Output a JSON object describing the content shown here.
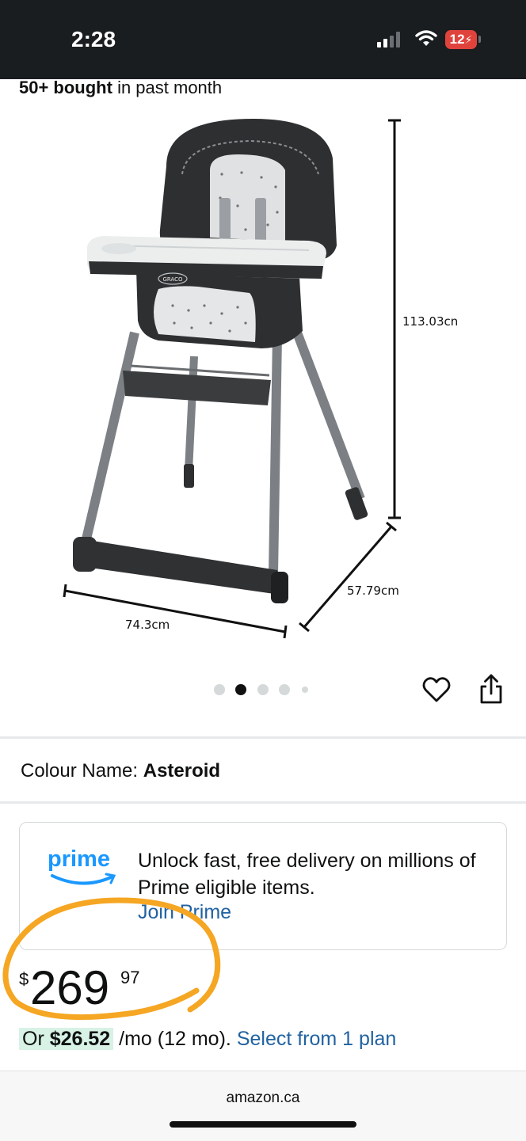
{
  "status_bar": {
    "time": "2:28",
    "battery": "12"
  },
  "product": {
    "bought": {
      "bold": "50+ bought",
      "rest": " in past month"
    },
    "dimensions": {
      "height": "113.03cn",
      "depth": "57.79cm",
      "width": "74.3cm"
    },
    "brand_badge": "GRACO",
    "image_count": 5,
    "active_image": 2
  },
  "variant": {
    "label": "Colour Name:",
    "value": "Asteroid"
  },
  "prime": {
    "logo_text": "prime",
    "message": "Unlock fast, free delivery on millions of Prime eligible items.",
    "join_link": "Join Prime"
  },
  "price": {
    "currency": "$",
    "whole": "269",
    "fraction": "97"
  },
  "installment": {
    "prefix": "Or",
    "amount": "$26.52",
    "suffix": "/mo (12 mo).",
    "link": "Select from 1 plan"
  },
  "footer": {
    "domain": "amazon.ca"
  },
  "colors": {
    "link": "#2162a1",
    "annotation": "#f5a623",
    "highlight": "#d8f2e6"
  }
}
